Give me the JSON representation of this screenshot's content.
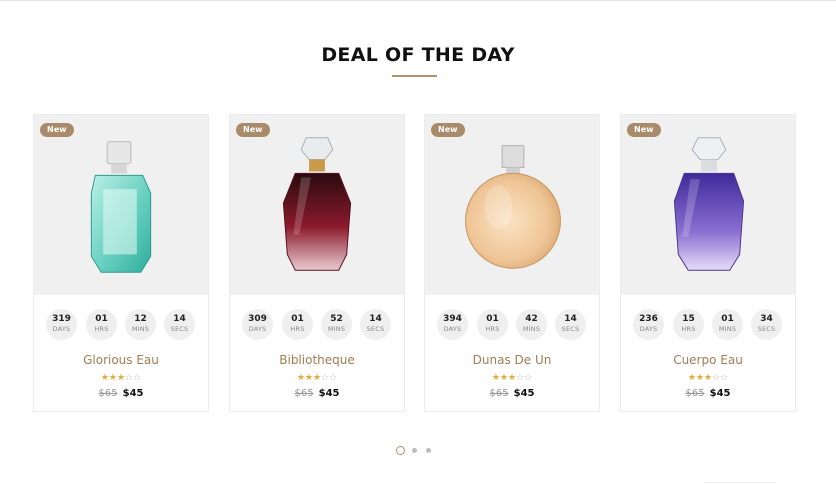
{
  "section": {
    "title": "DEAL OF THE DAY"
  },
  "colors": {
    "accent": "#b2906a",
    "badge": "#a98b6b",
    "star": "#e8a93a",
    "name": "#a17d55"
  },
  "products": [
    {
      "badge": "New",
      "name": "Glorious Eau",
      "rating": 3,
      "max_rating": 5,
      "old_price": "$65",
      "price": "$45",
      "bottle_icon": "perfume-bottle-teal-icon",
      "countdown": [
        {
          "value": "319",
          "label": "DAYS"
        },
        {
          "value": "01",
          "label": "HRS"
        },
        {
          "value": "12",
          "label": "MINS"
        },
        {
          "value": "14",
          "label": "SECS"
        }
      ]
    },
    {
      "badge": "New",
      "name": "Bibliotheque",
      "rating": 3,
      "max_rating": 5,
      "old_price": "$65",
      "price": "$45",
      "bottle_icon": "perfume-bottle-red-icon",
      "countdown": [
        {
          "value": "309",
          "label": "DAYS"
        },
        {
          "value": "01",
          "label": "HRS"
        },
        {
          "value": "52",
          "label": "MINS"
        },
        {
          "value": "14",
          "label": "SECS"
        }
      ]
    },
    {
      "badge": "New",
      "name": "Dunas De Un",
      "rating": 3,
      "max_rating": 5,
      "old_price": "$65",
      "price": "$45",
      "bottle_icon": "perfume-bottle-peach-icon",
      "countdown": [
        {
          "value": "394",
          "label": "DAYS"
        },
        {
          "value": "01",
          "label": "HRS"
        },
        {
          "value": "42",
          "label": "MINS"
        },
        {
          "value": "14",
          "label": "SECS"
        }
      ]
    },
    {
      "badge": "New",
      "name": "Cuerpo Eau",
      "rating": 3,
      "max_rating": 5,
      "old_price": "$65",
      "price": "$45",
      "bottle_icon": "perfume-bottle-purple-icon",
      "countdown": [
        {
          "value": "236",
          "label": "DAYS"
        },
        {
          "value": "15",
          "label": "HRS"
        },
        {
          "value": "01",
          "label": "MINS"
        },
        {
          "value": "34",
          "label": "SECS"
        }
      ]
    }
  ],
  "pagination": {
    "pages": 3,
    "active": 1
  }
}
